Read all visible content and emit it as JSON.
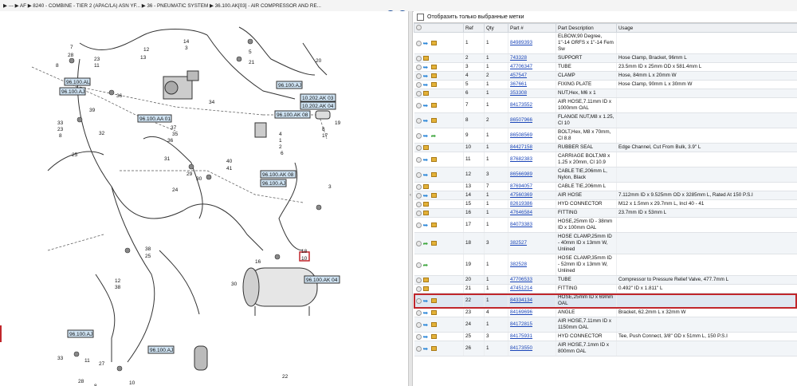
{
  "breadcrumb": {
    "items": [
      "---",
      "AF",
      "8240 - COMBINE - TIER 2 (APAC/LA) ASN YF...",
      "36 - PNEUMATIC SYSTEM",
      "36.100.AK[03] - AIR COMPRESSOR AND RE..."
    ]
  },
  "filter": {
    "label": "Отобразить только выбранные метки"
  },
  "table": {
    "headers": [
      "Ref",
      "Qty",
      "Part #",
      "Part Description",
      "Usage"
    ],
    "rows": [
      {
        "ref": "1",
        "qty": "1",
        "part": "84989393",
        "desc": "ELBOW,90 Degree, 1\"-14 ORFS x 1\"-14 Fem Sw",
        "usage": "",
        "icons": [
          "circle",
          "arrow",
          "box"
        ]
      },
      {
        "ref": "2",
        "qty": "1",
        "part": "743328",
        "desc": "SUPPORT",
        "usage": "Hose Clamp, Bracket, 96mm L",
        "icons": [
          "circle",
          "box"
        ]
      },
      {
        "ref": "3",
        "qty": "1",
        "part": "47706347",
        "desc": "TUBE",
        "usage": "23.5mm ID x 25mm OD x 581.4mm L",
        "icons": [
          "circle",
          "arrow",
          "box"
        ]
      },
      {
        "ref": "4",
        "qty": "2",
        "part": "457547",
        "desc": "CLAMP",
        "usage": "Hose, 84mm L x 20mm W",
        "icons": [
          "circle",
          "arrow",
          "box"
        ]
      },
      {
        "ref": "5",
        "qty": "1",
        "part": "367661",
        "desc": "FIXING PLATE",
        "usage": "Hose Clamp, 90mm L x 30mm W",
        "icons": [
          "circle",
          "arrow",
          "box"
        ]
      },
      {
        "ref": "6",
        "qty": "1",
        "part": "353308",
        "desc": "NUT,Hex, M6 x 1",
        "usage": "",
        "icons": [
          "circle",
          "box"
        ]
      },
      {
        "ref": "7",
        "qty": "1",
        "part": "84173552",
        "desc": "AIR HOSE,7.11mm ID x 1000mm OAL",
        "usage": "",
        "icons": [
          "circle",
          "arrow",
          "box"
        ]
      },
      {
        "ref": "8",
        "qty": "2",
        "part": "86507966",
        "desc": "FLANGE NUT,M8 x 1.25, Cl 10",
        "usage": "",
        "icons": [
          "circle",
          "arrow",
          "box"
        ]
      },
      {
        "ref": "9",
        "qty": "1",
        "part": "86508569",
        "desc": "BOLT,Hex, M8 x 70mm, Cl 8.8",
        "usage": "",
        "icons": [
          "circle",
          "arrow",
          "green"
        ]
      },
      {
        "ref": "10",
        "qty": "1",
        "part": "84427158",
        "desc": "RUBBER SEAL",
        "usage": "Edge Channel, Cut From Bulk, 3.9\" L",
        "icons": [
          "circle",
          "box"
        ]
      },
      {
        "ref": "11",
        "qty": "1",
        "part": "87682383",
        "desc": "CARRIAGE BOLT,M8 x 1.25 x 20mm, Cl 10.9",
        "usage": "",
        "icons": [
          "circle",
          "arrow",
          "box"
        ]
      },
      {
        "ref": "12",
        "qty": "3",
        "part": "86566989",
        "desc": "CABLE TIE,206mm L, Nylon, Black",
        "usage": "",
        "icons": [
          "circle",
          "arrow",
          "box"
        ]
      },
      {
        "ref": "13",
        "qty": "7",
        "part": "87694057",
        "desc": "CABLE TIE,206mm L",
        "usage": "",
        "icons": [
          "circle",
          "box"
        ]
      },
      {
        "ref": "14",
        "qty": "1",
        "part": "47560369",
        "desc": "AIR HOSE",
        "usage": "7.112mm ID x 9.525mm OD x 3285mm L, Rated At 150 P.S.I",
        "icons": [
          "circle",
          "arrow",
          "box"
        ]
      },
      {
        "ref": "15",
        "qty": "1",
        "part": "82619386",
        "desc": "HYD CONNECTOR",
        "usage": "M12 x 1.5mm x 29.7mm L, Incl 40 - 41",
        "icons": [
          "circle",
          "box"
        ]
      },
      {
        "ref": "16",
        "qty": "1",
        "part": "47646584",
        "desc": "FITTING",
        "usage": "23.7mm ID x 53mm L",
        "icons": [
          "circle",
          "box"
        ]
      },
      {
        "ref": "17",
        "qty": "1",
        "part": "84073383",
        "desc": "HOSE,25mm ID - 38mm ID x 100mm OAL",
        "usage": "",
        "icons": [
          "circle",
          "arrow",
          "box"
        ]
      },
      {
        "ref": "18",
        "qty": "3",
        "part": "382527",
        "desc": "HOSE CLAMP,25mm ID - 40mm ID x 13mm W, Unlined",
        "usage": "",
        "icons": [
          "circle",
          "green",
          "box"
        ]
      },
      {
        "ref": "19",
        "qty": "1",
        "part": "382528",
        "desc": "HOSE CLAMP,35mm ID - 52mm ID x 13mm W, Unlined",
        "usage": "",
        "icons": [
          "circle",
          "green"
        ]
      },
      {
        "ref": "20",
        "qty": "1",
        "part": "47706533",
        "desc": "TUBE",
        "usage": "Compressor to Pressure Relief Valve, 477.7mm L",
        "icons": [
          "circle",
          "box"
        ]
      },
      {
        "ref": "21",
        "qty": "1",
        "part": "47451214",
        "desc": "FITTING",
        "usage": "0.492\" ID x 1.811\" L",
        "icons": [
          "circle",
          "box"
        ]
      },
      {
        "ref": "22",
        "qty": "1",
        "part": "84334134",
        "desc": "HOSE,25mm ID x 69mm OAL",
        "usage": "",
        "icons": [
          "circle",
          "arrow",
          "box"
        ],
        "selected": true
      },
      {
        "ref": "23",
        "qty": "4",
        "part": "84169696",
        "desc": "ANGLE",
        "usage": "Bracket, 62.2mm L x 32mm W",
        "icons": [
          "circle",
          "arrow",
          "box"
        ]
      },
      {
        "ref": "24",
        "qty": "1",
        "part": "84172815",
        "desc": "AIR HOSE,7.11mm ID x 1150mm OAL",
        "usage": "",
        "icons": [
          "circle",
          "arrow",
          "box"
        ]
      },
      {
        "ref": "25",
        "qty": "3",
        "part": "84175931",
        "desc": "HYD CONNECTOR",
        "usage": "Tee, Push Connect, 3/8\" OD x 51mm L, 150 P.S.I",
        "icons": [
          "circle",
          "arrow",
          "box"
        ]
      },
      {
        "ref": "26",
        "qty": "1",
        "part": "84173550",
        "desc": "AIR HOSE,7.1mm ID x 800mm OAL",
        "usage": "",
        "icons": [
          "circle",
          "arrow",
          "box"
        ]
      }
    ]
  },
  "diagram": {
    "callouts": [
      "96.100.AL",
      "96.100.AJ",
      "96.100.AA 01",
      "96.100.AK 08",
      "96.100.AJ",
      "10.202.AK 03",
      "10.202.AK 04",
      "96.100.AK 08",
      "96.100.AJ",
      "96.100.AK 04",
      "96.100.AJ",
      "96.100.AJ"
    ],
    "numbers": [
      "7",
      "28",
      "23",
      "11",
      "8",
      "12",
      "13",
      "14",
      "3",
      "5",
      "21",
      "20",
      "34",
      "36",
      "39",
      "33",
      "23",
      "8",
      "32",
      "37",
      "35",
      "36",
      "31",
      "29",
      "30",
      "40",
      "41",
      "18",
      "10",
      "16",
      "19",
      "8",
      "4",
      "1",
      "2",
      "6",
      "17",
      "3",
      "25",
      "24",
      "38",
      "25",
      "12",
      "38",
      "30",
      "22",
      "33",
      "28",
      "11",
      "27",
      "8",
      "10"
    ]
  },
  "colors": {
    "accent": "#3a7bd5",
    "selection": "#c0262b",
    "callout_bg": "#cfe3f3"
  }
}
